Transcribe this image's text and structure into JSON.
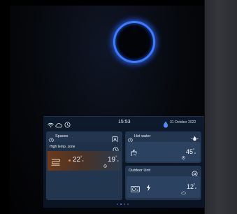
{
  "status_bar": {
    "time": "15:53",
    "date": "31 October 2022"
  },
  "spaces": {
    "title": "Spaces",
    "zone_label": "High temp. zone",
    "temp_current": "22",
    "temp_current_unit": "°",
    "temp_current_sub": "c",
    "temp_target": "19",
    "temp_target_unit": "°",
    "temp_target_sub": "c"
  },
  "hot_water": {
    "title": "Hot water",
    "temperature": "45",
    "temp_unit": "°",
    "temp_sub": "c"
  },
  "outdoor_unit": {
    "title": "Outdoor Unit",
    "temperature": "12",
    "temp_unit": "°",
    "temp_sub": "c"
  },
  "pagination": {
    "pages": 4,
    "active_index": 1
  },
  "colors": {
    "accent_orange": "#e08a3c",
    "ring_blue": "#3d7bff",
    "card_bg": "#22364f",
    "subcard_bg": "#2b4260",
    "heat_gradient_end": "#6b3a1c"
  },
  "icons": {
    "wifi": "wifi-icon",
    "cloud": "cloud-icon",
    "mode": "mode-icon",
    "water_drop": "water-drop-icon",
    "clock": "clock-icon",
    "floor_heating": "floor-heating-icon",
    "tap": "tap-icon",
    "fan_unit": "fan-unit-icon",
    "lightning": "lightning-icon"
  }
}
